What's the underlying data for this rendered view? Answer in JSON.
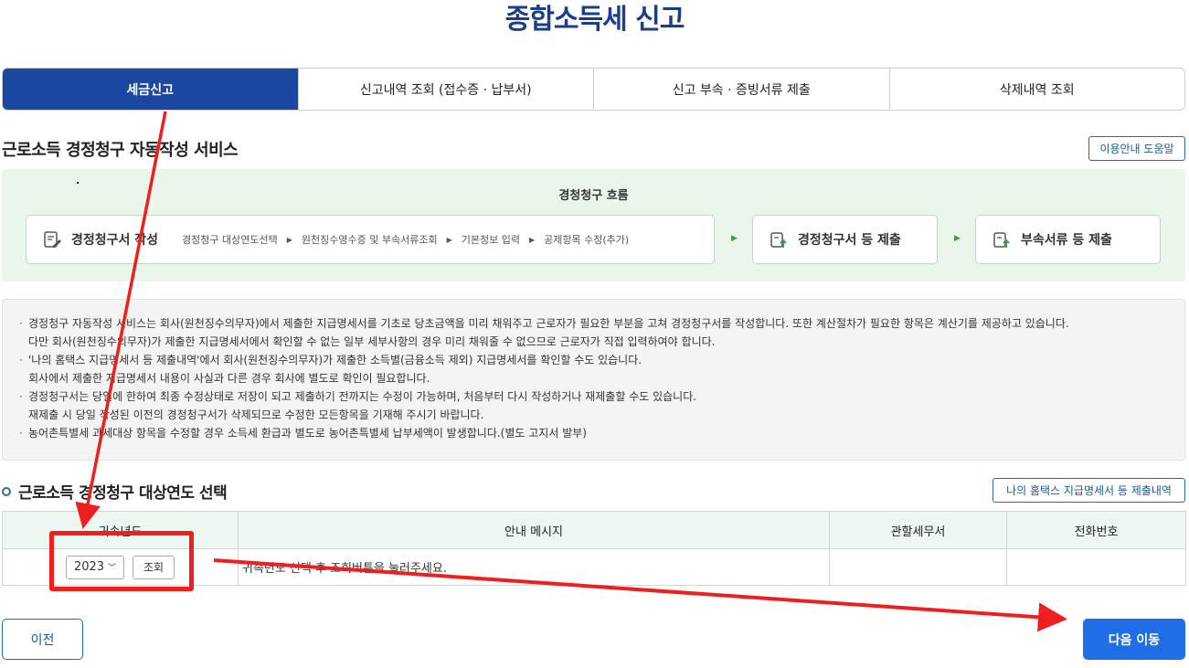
{
  "page": {
    "title": "종합소득세 신고"
  },
  "tabs": [
    {
      "label": "세금신고",
      "active": true
    },
    {
      "label": "신고내역 조회 (접수증 · 납부서)",
      "active": false
    },
    {
      "label": "신고 부속 · 증빙서류 제출",
      "active": false
    },
    {
      "label": "삭제내역 조회",
      "active": false
    }
  ],
  "section": {
    "title": "근로소득 경정청구 자동작성 서비스",
    "help_label": "이용안내 도움말"
  },
  "flow": {
    "title": "경청청구 흐름",
    "steps": [
      {
        "label": "경정청구서 작성",
        "icon": "document-edit-icon"
      },
      {
        "label": "경정청구서 등 제출",
        "icon": "document-upload-icon"
      },
      {
        "label": "부속서류 등 제출",
        "icon": "document-upload-icon"
      }
    ],
    "substeps": [
      "경정청구 대상연도선택",
      "원천징수영수증 및 부속서류조회",
      "기본정보 입력",
      "공제항목 수정(추가)"
    ]
  },
  "notice": {
    "items": [
      {
        "line1": "경정청구 자동작성 서비스는 회사(원천징수의무자)에서 제출한 지급명세서를 기초로 당초금액을 미리 채워주고 근로자가 필요한 부분을 고쳐 경정청구서를 작성합니다. 또한 계산절차가 필요한 항목은 계산기를 제공하고 있습니다.",
        "line2": "다만 회사(원천징수의무자)가 제출한 지급명세서에서 확인할 수 없는 일부 세부사항의 경우 미리 채워줄 수 없으므로 근로자가 직접 입력하여야 합니다."
      },
      {
        "line1": "'나의 홈택스 지급명세서 등 제출내역'에서 회사(원천징수의무자)가 제출한 소득별(금융소득 제외) 지급명세서를 확인할 수도 있습니다.",
        "line2": "회사에서 제출한 지급명세서 내용이 사실과 다른 경우 회사에 별도로 확인이 필요합니다."
      },
      {
        "line1": "경정청구서는 당일에 한하여 최종 수정상태로 저장이 되고 제출하기 전까지는 수정이 가능하며, 처음부터 다시 작성하거나 재제출할 수도 있습니다.",
        "line2": "재제출 시 당일 작성된 이전의 경정청구서가 삭제되므로 수정한 모든항목을 기재해 주시기 바랍니다."
      },
      {
        "line1": "농어촌특별세 과세대상 항목을 수정할 경우 소득세 환급과 별도로 농어촌특별세 납부세액이 발생합니다.(별도 고지서 발부)",
        "line2": ""
      }
    ]
  },
  "year_section": {
    "title": "근로소득 경정청구 대상연도 선택",
    "hometax_label": "나의 홈택스 지급명세서 등 제출내역",
    "columns": [
      "귀속년도",
      "안내 메시지",
      "관할세무서",
      "전화번호"
    ],
    "row": {
      "year": "2023",
      "query_label": "조회",
      "message": "귀속년도 선택 후 조회버튼을 눌러주세요.",
      "tax_office": "",
      "phone": ""
    }
  },
  "footer": {
    "prev_label": "이전",
    "next_label": "다음 이동"
  },
  "colors": {
    "primary": "#1b47a0",
    "accent_blue": "#1f6ee8",
    "flow_bg": "#eaf5ec",
    "annotation_red": "#f01f1f"
  }
}
